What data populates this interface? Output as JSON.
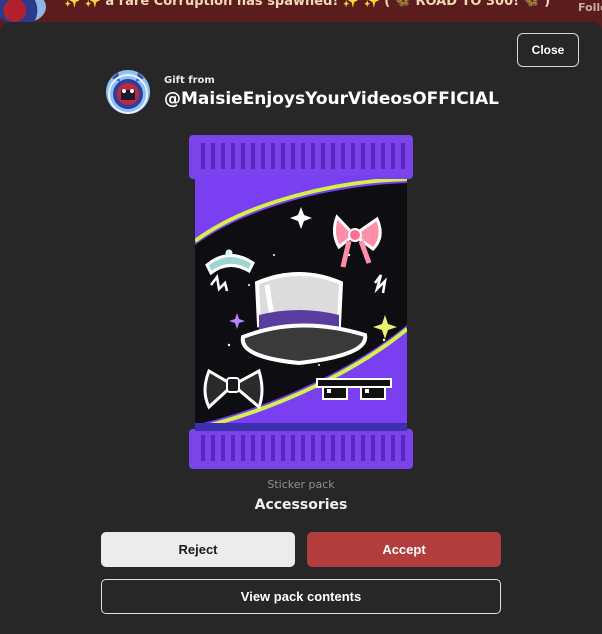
{
  "background": {
    "ticker_text": "✨ ✨ a rare Corruption has spawned! ✨ ✨ ( 🦋 ROAD TO 300! 🦋 )",
    "follow_label": "Follo"
  },
  "modal": {
    "close_label": "Close",
    "gift_from_label": "Gift from",
    "sender_username": "@MaisieEnjoysYourVideosOFFICIAL",
    "pack_type": "Sticker pack",
    "pack_name": "Accessories",
    "reject_label": "Reject",
    "accept_label": "Accept",
    "view_contents_label": "View pack contents"
  },
  "icons": {
    "pack_stickers": [
      "tiara-icon",
      "bow-icon",
      "top-hat-icon",
      "bow-tie-icon",
      "pixel-sunglasses-icon",
      "sparkle-icon"
    ]
  },
  "colors": {
    "modal_bg": "#272727",
    "accept_bg": "#b13d3d",
    "reject_bg": "#ececec",
    "pack_purple": "#7a3ff0",
    "pack_stripe": "#d4f04a"
  }
}
